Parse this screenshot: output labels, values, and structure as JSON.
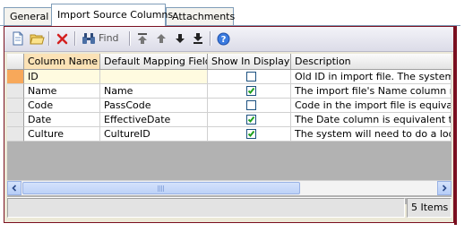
{
  "tabs": [
    {
      "label": "General",
      "active": false
    },
    {
      "label": "Import Source Columns",
      "active": true
    },
    {
      "label": "Attachments",
      "active": false
    }
  ],
  "toolbar": {
    "find_label": "Find",
    "icons": [
      "new-document-icon",
      "open-folder-icon",
      "delete-icon",
      "find-binoculars-icon",
      "move-top-icon",
      "move-up-icon",
      "move-down-icon",
      "move-bottom-icon",
      "help-icon"
    ]
  },
  "grid": {
    "columns": [
      "Column Name",
      "Default Mapping Field",
      "Show In Display",
      "Description"
    ],
    "rows": [
      {
        "column_name": "ID",
        "mapping": "",
        "show": false,
        "description": "Old ID in import file.  The system will",
        "selected": true
      },
      {
        "column_name": "Name",
        "mapping": "Name",
        "show": true,
        "description": "The import file's Name column maps"
      },
      {
        "column_name": "Code",
        "mapping": "PassCode",
        "show": false,
        "description": "Code in the import file is equivalent"
      },
      {
        "column_name": "Date",
        "mapping": "EffectiveDate",
        "show": true,
        "description": "The Date column is equivalent to the"
      },
      {
        "column_name": "Culture",
        "mapping": "CultureID",
        "show": true,
        "description": "The system will need to do a lookup"
      }
    ]
  },
  "status": {
    "item_count": "5 Items"
  },
  "colors": {
    "accent_border": "#7a0f1f",
    "selected_row_header": "#f7a85a",
    "edit_cell": "#fffbe0"
  }
}
